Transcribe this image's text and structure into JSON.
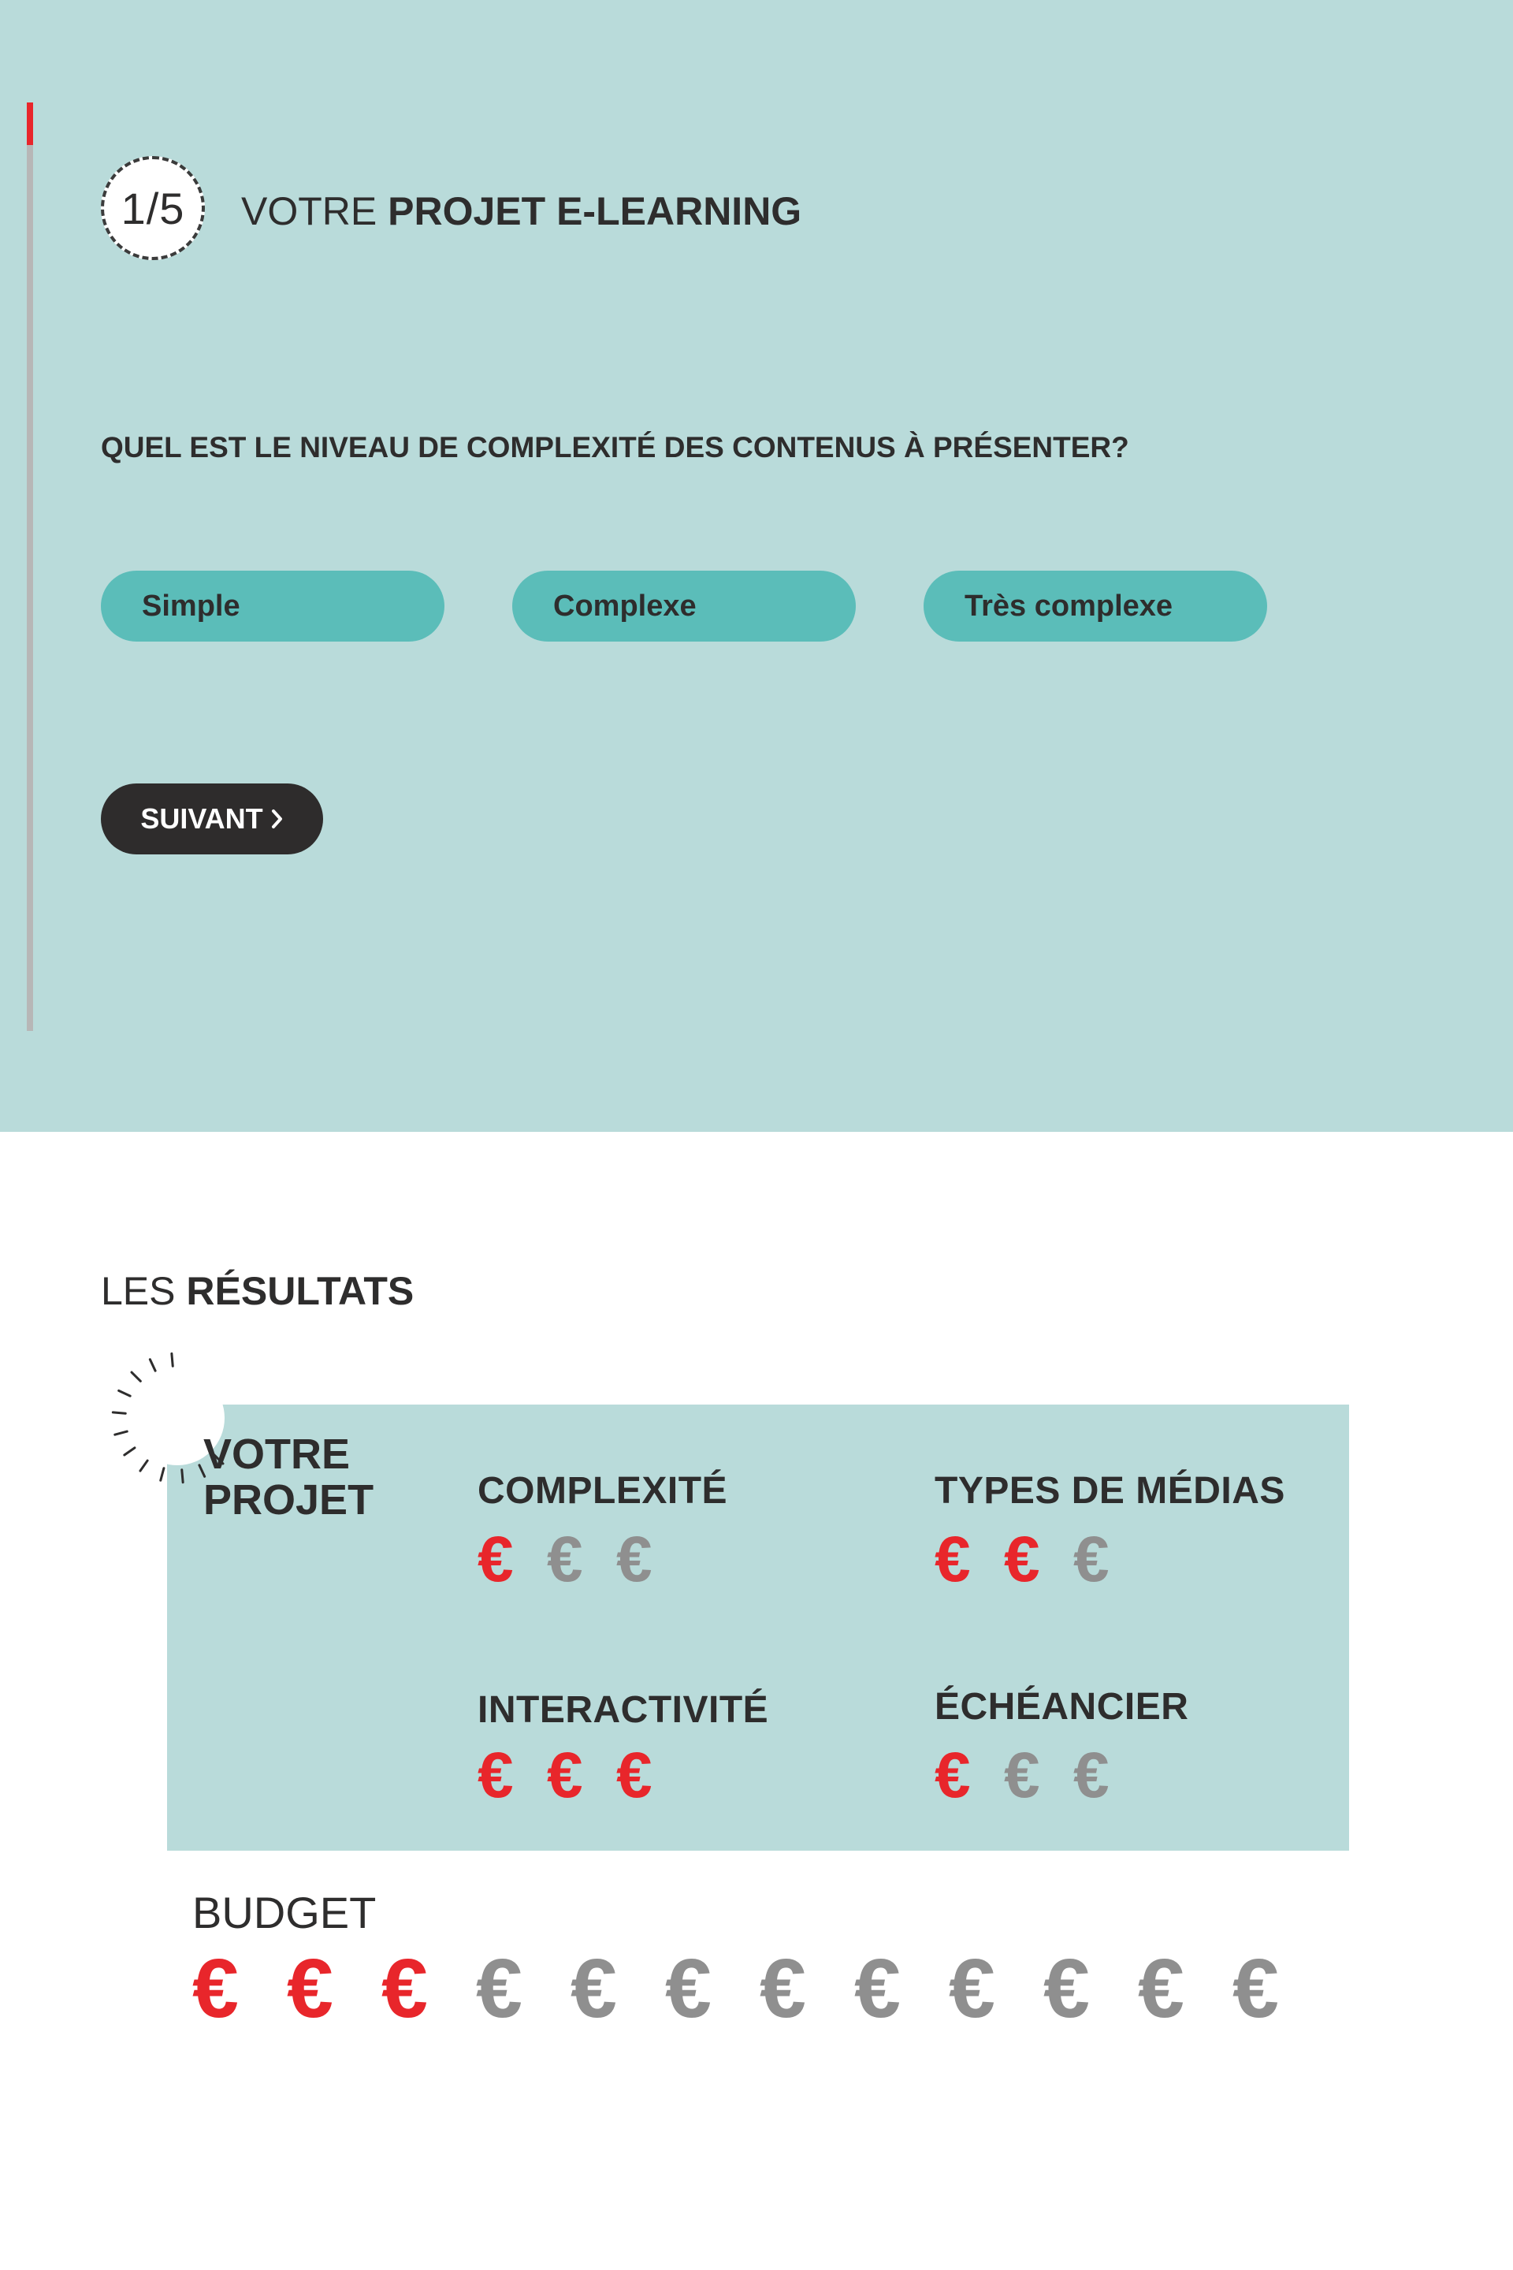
{
  "quiz": {
    "step": "1/5",
    "title_light": "VOTRE ",
    "title_bold": "PROJET E-LEARNING",
    "question": "QUEL EST LE NIVEAU DE COMPLEXITÉ DES CONTENUS À PRÉSENTER?",
    "answers": [
      "Simple",
      "Complexe",
      "Très complexe"
    ],
    "next_label": "SUIVANT",
    "next_icon": "chevron-right-icon",
    "progress": 0.2
  },
  "results": {
    "heading_light": "LES ",
    "heading_bold": "RÉSULTATS",
    "card_title_line1": "VOTRE",
    "card_title_line2": "PROJET",
    "metrics": [
      {
        "label": "COMPLEXITÉ",
        "level": 1,
        "max": 3
      },
      {
        "label": "TYPES DE MÉDIAS",
        "level": 2,
        "max": 3
      },
      {
        "label": "INTERACTIVITÉ",
        "level": 3,
        "max": 3
      },
      {
        "label": "ÉCHÉANCIER",
        "level": 1,
        "max": 3
      }
    ],
    "budget_label": "BUDGET",
    "budget_level": 3,
    "budget_max": 12,
    "symbol": "€"
  },
  "colors": {
    "panel": "#b9dbda",
    "accent": "#e8262b",
    "button": "#5bbdb9",
    "dark": "#2e2c2c",
    "inactive": "#8f8f8f"
  }
}
